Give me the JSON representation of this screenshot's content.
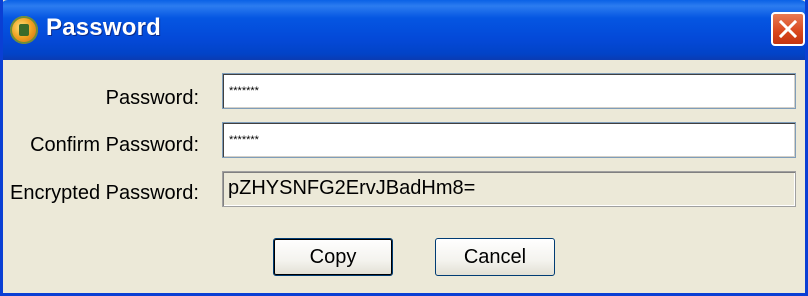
{
  "window": {
    "title": "Password",
    "icon": "app-globe-icon",
    "close_icon": "close-icon"
  },
  "form": {
    "password_label": "Password:",
    "password_value": "*******",
    "confirm_label": "Confirm Password:",
    "confirm_value": "*******",
    "encrypted_label": "Encrypted Password:",
    "encrypted_value": "pZHYSNFG2ErvJBadHm8="
  },
  "buttons": {
    "copy_label": "Copy",
    "cancel_label": "Cancel"
  },
  "colors": {
    "titlebar": "#0449d8",
    "dialog_background": "#ece9d8",
    "close_button": "#d9461c"
  }
}
